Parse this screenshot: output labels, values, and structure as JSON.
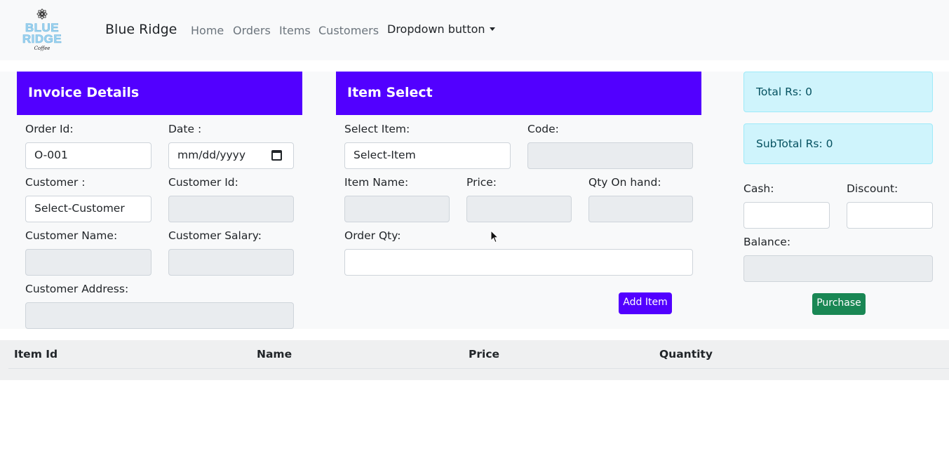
{
  "navbar": {
    "logo": {
      "line1": "BLUE",
      "line2": "RIDGE",
      "tagline": "Coffee"
    },
    "brand": "Blue Ridge",
    "links": [
      "Home",
      "Orders",
      "Items",
      "Customers"
    ],
    "dropdown_label": "Dropdown button"
  },
  "invoice": {
    "title": "Invoice Details",
    "order_id_label": "Order Id:",
    "order_id_value": "O-001",
    "date_label": "Date :",
    "date_placeholder": "mm/dd/yyyy",
    "customer_label": "Customer :",
    "customer_value": "Select-Customer",
    "customer_id_label": "Customer Id:",
    "customer_name_label": "Customer Name:",
    "customer_salary_label": "Customer Salary:",
    "customer_address_label": "Customer Address:"
  },
  "item_select": {
    "title": "Item Select",
    "select_item_label": "Select Item:",
    "select_item_value": "Select-Item",
    "code_label": "Code:",
    "item_name_label": "Item Name:",
    "price_label": "Price:",
    "qty_on_hand_label": "Qty On hand:",
    "order_qty_label": "Order Qty:",
    "add_button": "Add Item"
  },
  "summary": {
    "total": "Total Rs: 0",
    "subtotal": "SubTotal Rs: 0",
    "cash_label": "Cash:",
    "discount_label": "Discount:",
    "balance_label": "Balance:",
    "purchase_button": "Purchase"
  },
  "table": {
    "headers": [
      "Item Id",
      "Name",
      "Price",
      "Quantity"
    ],
    "rows": []
  },
  "colors": {
    "panel_header": "#5200ff",
    "purchase_button": "#198754",
    "alert_bg": "#cff4fc",
    "alert_text": "#055160"
  }
}
